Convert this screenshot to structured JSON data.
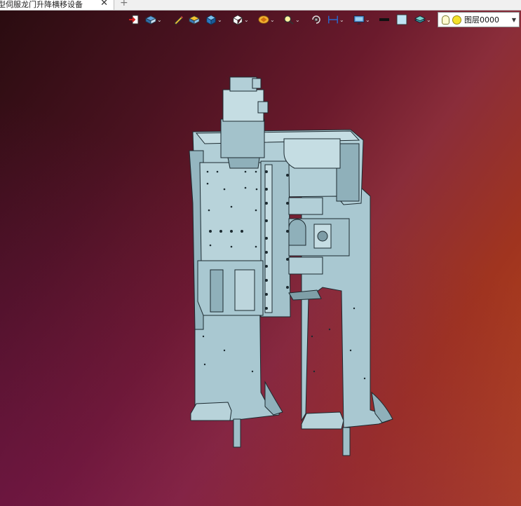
{
  "tab": {
    "title": "型伺服龙门升降横移设备",
    "close_glyph": "✕",
    "add_glyph": "+"
  },
  "toolbar": {
    "tools": [
      {
        "name": "exit-sketch-icon",
        "dropdown": false
      },
      {
        "name": "view-orientation-icon",
        "dropdown": true
      },
      {
        "name": "pencil-edit-icon",
        "dropdown": false
      },
      {
        "name": "shaded-box-icon",
        "dropdown": false
      },
      {
        "name": "blue-cube-icon",
        "dropdown": true
      },
      {
        "name": "wireframe-cube-icon",
        "dropdown": true
      },
      {
        "name": "render-style-icon",
        "dropdown": true
      },
      {
        "name": "zoom-fit-icon",
        "dropdown": true
      },
      {
        "name": "rotate-icon",
        "dropdown": false
      },
      {
        "name": "dimension-icon",
        "dropdown": true
      },
      {
        "name": "display-monitor-icon",
        "dropdown": true
      },
      {
        "name": "black-line-icon",
        "dropdown": false
      },
      {
        "name": "light-blue-square-icon",
        "dropdown": false
      },
      {
        "name": "layers-icon",
        "dropdown": true
      }
    ],
    "layer_select": {
      "value": "图层0000"
    }
  },
  "colors": {
    "part": "#9fbfc8",
    "part_dark": "#7f9fa8",
    "edge": "#1c2a30"
  }
}
